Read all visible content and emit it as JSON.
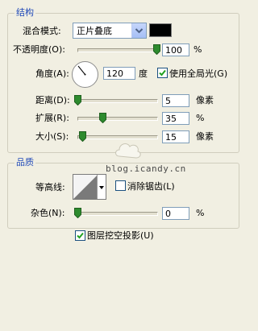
{
  "structure": {
    "legend": "结构",
    "blend_mode": {
      "label": "混合模式:",
      "value": "正片叠底",
      "color": "#000000"
    },
    "opacity": {
      "label": "不透明度(O):",
      "value": "100",
      "unit": "%",
      "level": 1.0
    },
    "angle": {
      "label": "角度(A):",
      "value": "120",
      "unit": "度",
      "global_light_label": "使用全局光(G)",
      "global_light_checked": true
    },
    "distance": {
      "label": "距离(D):",
      "value": "5",
      "unit": "像素",
      "level": 0.0
    },
    "spread": {
      "label": "扩展(R):",
      "value": "35",
      "unit": "%",
      "level": 0.35
    },
    "size": {
      "label": "大小(S):",
      "value": "15",
      "unit": "像素",
      "level": 0.06
    }
  },
  "quality": {
    "legend": "品质",
    "contour": {
      "label": "等高线:",
      "anti_alias_label": "消除锯齿(L)",
      "anti_alias_checked": false
    },
    "noise": {
      "label": "杂色(N):",
      "value": "0",
      "unit": "%",
      "level": 0.0
    }
  },
  "knockout": {
    "label": "图层挖空投影(U)",
    "checked": true
  },
  "watermark": "blog.icandy.cn"
}
